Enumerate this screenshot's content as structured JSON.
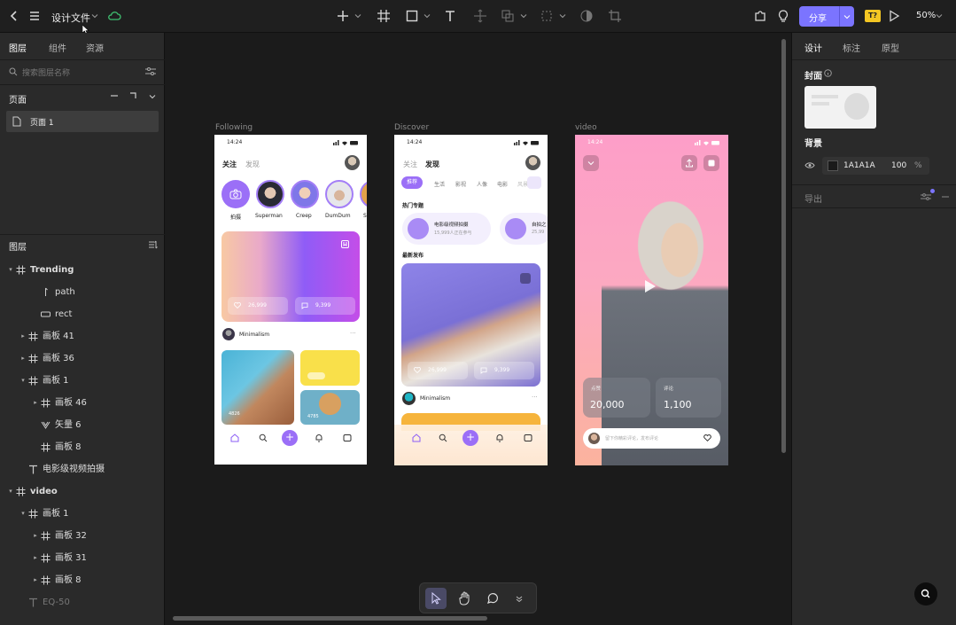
{
  "topbar": {
    "file_name": "设计文件",
    "share_label": "分享",
    "zoom": "50%",
    "badge": "T?"
  },
  "left_tabs": [
    {
      "label": "图层",
      "active": true
    },
    {
      "label": "组件",
      "active": false
    },
    {
      "label": "资源",
      "active": false
    }
  ],
  "search": {
    "placeholder": "搜索图层名称"
  },
  "pages": {
    "title": "页面",
    "items": [
      {
        "label": "页面 1"
      }
    ]
  },
  "layers": {
    "title": "图层",
    "items": [
      {
        "label": "Trending",
        "depth": 0,
        "expanded": true,
        "icon": "frame-icon"
      },
      {
        "label": "path",
        "depth": 2,
        "icon": "path-icon"
      },
      {
        "label": "rect",
        "depth": 2,
        "icon": "rect-icon"
      },
      {
        "label": "画板 41",
        "depth": 1,
        "expanded": false,
        "icon": "frame-icon"
      },
      {
        "label": "画板 36",
        "depth": 1,
        "expanded": false,
        "icon": "frame-icon"
      },
      {
        "label": "画板 1",
        "depth": 1,
        "expanded": true,
        "icon": "frame-icon"
      },
      {
        "label": "画板 46",
        "depth": 2,
        "expanded": false,
        "icon": "frame-icon"
      },
      {
        "label": "矢量 6",
        "depth": 2,
        "icon": "vector-icon"
      },
      {
        "label": "画板 8",
        "depth": 2,
        "icon": "frame-icon"
      },
      {
        "label": "电影级视频拍摄",
        "depth": 1,
        "icon": "text-icon"
      },
      {
        "label": "video",
        "depth": 0,
        "expanded": true,
        "icon": "frame-icon"
      },
      {
        "label": "画板 1",
        "depth": 1,
        "expanded": true,
        "icon": "frame-icon"
      },
      {
        "label": "画板 32",
        "depth": 2,
        "expanded": false,
        "icon": "frame-icon"
      },
      {
        "label": "画板 31",
        "depth": 2,
        "expanded": false,
        "icon": "frame-icon"
      },
      {
        "label": "画板 8",
        "depth": 2,
        "expanded": false,
        "icon": "frame-icon"
      },
      {
        "label": "EQ-50",
        "depth": 1,
        "icon": "text-icon",
        "dim": true
      }
    ]
  },
  "right_tabs": [
    {
      "label": "设计",
      "active": true
    },
    {
      "label": "标注",
      "active": false
    },
    {
      "label": "原型",
      "active": false
    }
  ],
  "cover": {
    "title": "封面"
  },
  "background": {
    "title": "背景",
    "hex": "1A1A1A",
    "opacity": "100",
    "unit": "%"
  },
  "export": {
    "title": "导出"
  },
  "frames": {
    "following": {
      "label": "Following",
      "status_time": "14:24",
      "tabs": [
        "关注",
        "发现"
      ],
      "stories": [
        "拍摄",
        "Superman",
        "Creep",
        "DumDum",
        "S"
      ],
      "card": {
        "likes": "26,999",
        "comments": "9,399"
      },
      "user": "Minimalism",
      "small_count_a": "4826",
      "small_count_b": "4785"
    },
    "discover": {
      "label": "Discover",
      "status_time": "14:24",
      "tabs": [
        "关注",
        "发现"
      ],
      "chips": [
        "推荐",
        "生活",
        "影视",
        "人像",
        "电影",
        "风景"
      ],
      "hot_title": "热门专题",
      "topic_a": "电影级视频拍摄",
      "topic_a_sub": "15,999人正在参与",
      "topic_b": "自拍之",
      "topic_b_sub": "25,99",
      "latest_title": "最新发布",
      "likes": "26,999",
      "comments": "9,399",
      "user": "Minimalism"
    },
    "video": {
      "label": "video",
      "status_time": "14:24",
      "stat_a_label": "点赞",
      "stat_a": "20,000",
      "stat_b_label": "评论",
      "stat_b": "1,100",
      "comment_placeholder": "留下你精彩评论，发布评论"
    }
  },
  "colors": {
    "accent": "#8b5cf6",
    "share": "#7b74ff",
    "canvas": "#1b1b1b",
    "panel": "#2a2a2a"
  }
}
